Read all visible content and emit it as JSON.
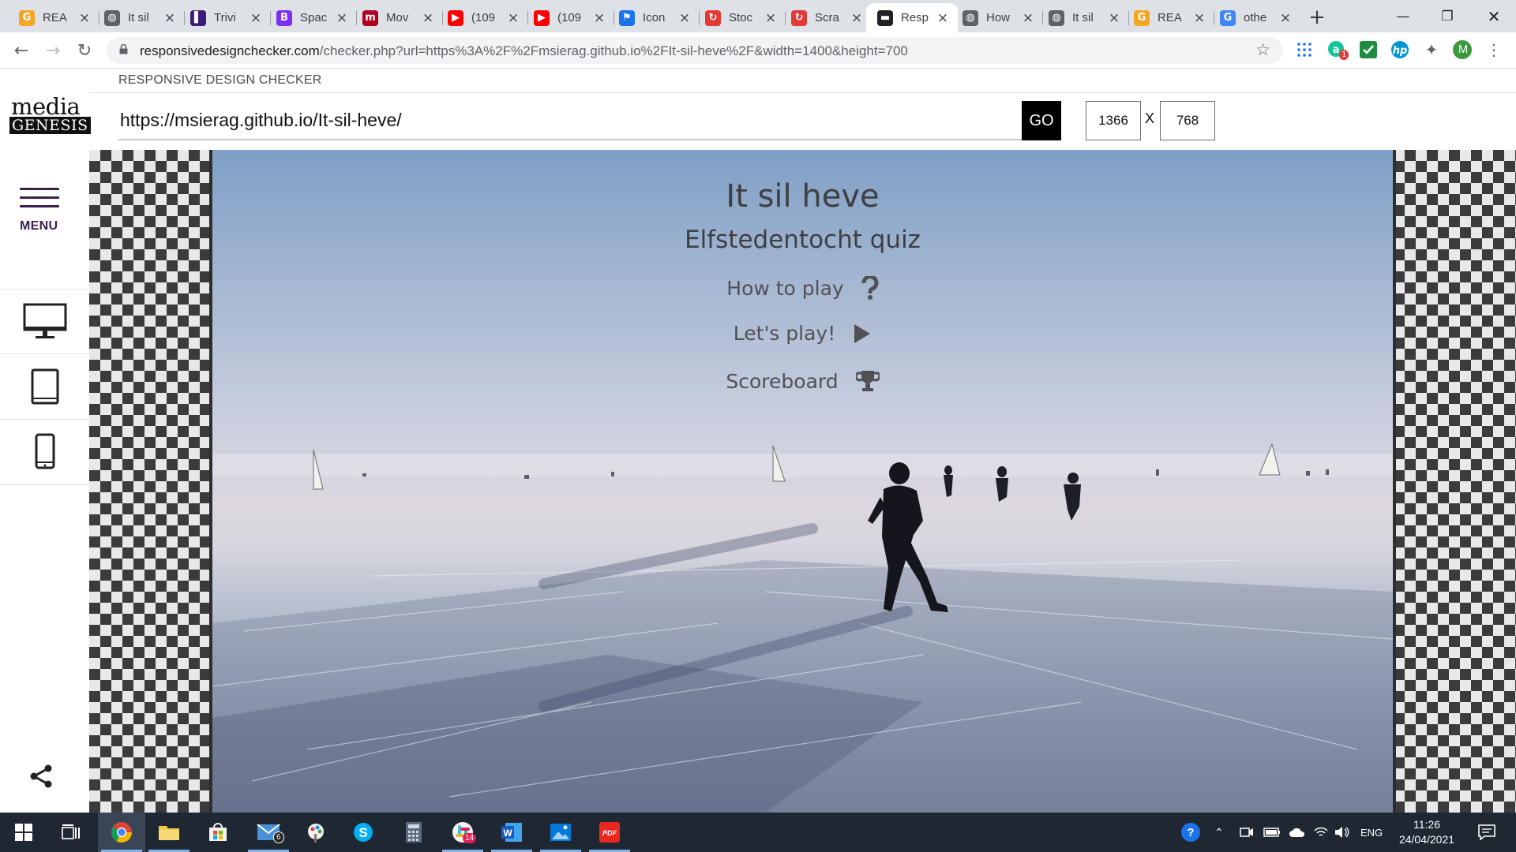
{
  "browser": {
    "tabs": [
      {
        "title": "REA",
        "fav": "G",
        "color": "#f5a623",
        "icon": "refresh-g-icon"
      },
      {
        "title": "It sil",
        "fav": "◍",
        "color": "#5f6368",
        "icon": "globe-icon"
      },
      {
        "title": "Trivi",
        "fav": "▌",
        "color": "#3c1a78",
        "icon": "trivia-icon"
      },
      {
        "title": "Spac",
        "fav": "B",
        "color": "#7b2ff7",
        "icon": "bootstrap-icon"
      },
      {
        "title": "Mov",
        "fav": "m",
        "color": "#b00020",
        "icon": "movie-icon"
      },
      {
        "title": "(109",
        "fav": "▶",
        "color": "#ff0000",
        "icon": "youtube-icon"
      },
      {
        "title": "(109",
        "fav": "▶",
        "color": "#ff0000",
        "icon": "youtube-icon"
      },
      {
        "title": "Icon",
        "fav": "⚑",
        "color": "#1a73e8",
        "icon": "flag-icon"
      },
      {
        "title": "Stoc",
        "fav": "↻",
        "color": "#e53935",
        "icon": "stackoverflow-icon"
      },
      {
        "title": "Scra",
        "fav": "↻",
        "color": "#e53935",
        "icon": "stackoverflow-icon"
      },
      {
        "title": "Resp",
        "fav": "▬",
        "color": "#202124",
        "icon": "responsive-icon"
      },
      {
        "title": "How",
        "fav": "◍",
        "color": "#5f6368",
        "icon": "globe-icon"
      },
      {
        "title": "It sil",
        "fav": "◍",
        "color": "#5f6368",
        "icon": "globe-icon"
      },
      {
        "title": "REA",
        "fav": "G",
        "color": "#f5a623",
        "icon": "refresh-g-icon"
      },
      {
        "title": "othe",
        "fav": "G",
        "color": "#4285f4",
        "icon": "google-icon"
      }
    ],
    "url_host": "responsivedesignchecker.com",
    "url_path": "/checker.php?url=https%3A%2F%2Fmsierag.github.io%2FIt-sil-heve%2F&width=1400&height=700",
    "profile_initial": "M",
    "ext_badge": "1"
  },
  "checker": {
    "header_label": "RESPONSIVE DESIGN CHECKER",
    "logo_top": "media",
    "logo_bottom": "GENESIS",
    "menu_label": "MENU",
    "url_value": "https://msierag.github.io/It-sil-heve/",
    "go_label": "GO",
    "width_value": "1366",
    "height_value": "768",
    "x_label": "X"
  },
  "site": {
    "title": "It sil heve",
    "subtitle": "Elfstedentocht quiz",
    "buttons": [
      {
        "label": "How to play",
        "icon": "question-icon"
      },
      {
        "label": "Let's play!",
        "icon": "play-icon"
      },
      {
        "label": "Scoreboard",
        "icon": "trophy-icon"
      }
    ]
  },
  "taskbar": {
    "mail_badge": "6",
    "slack_badge": "14",
    "lang": "ENG",
    "time": "11:26",
    "date": "24/04/2021"
  }
}
